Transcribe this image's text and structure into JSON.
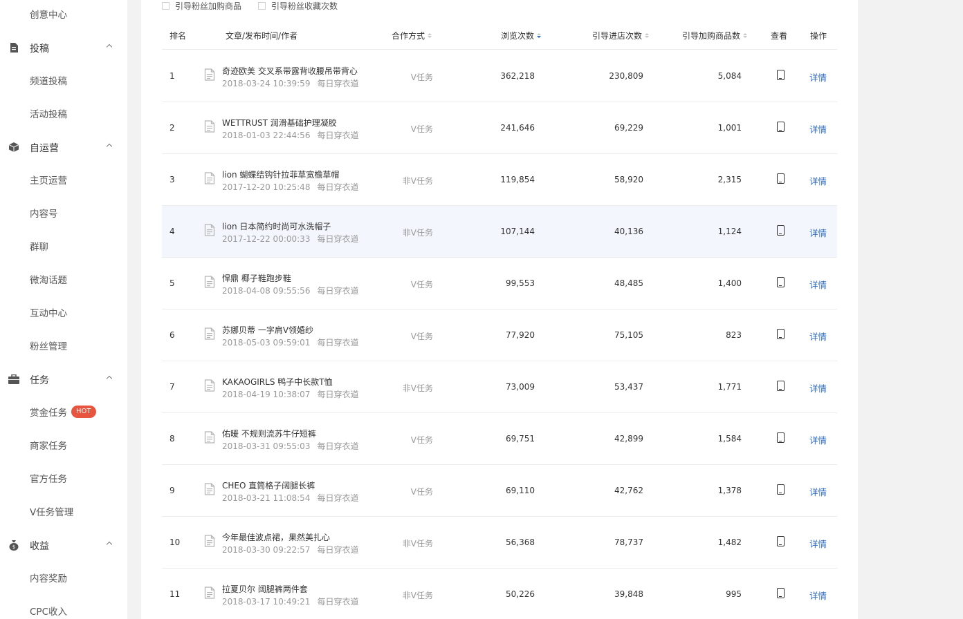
{
  "sidebar": {
    "top_item": "创意中心",
    "groups": [
      {
        "label": "投稿",
        "icon": "document-icon",
        "items": [
          "频道投稿",
          "活动投稿"
        ]
      },
      {
        "label": "自运营",
        "icon": "cube-icon",
        "items": [
          "主页运营",
          "内容号",
          "群聊",
          "微淘话题",
          "互动中心",
          "粉丝管理"
        ]
      },
      {
        "label": "任务",
        "icon": "briefcase-icon",
        "items": [
          "赏金任务",
          "商家任务",
          "官方任务",
          "V任务管理"
        ],
        "badge": "HOT"
      },
      {
        "label": "收益",
        "icon": "money-bag-icon",
        "items": [
          "内容奖励",
          "CPC收入"
        ]
      }
    ]
  },
  "filters": [
    "引导粉丝加购商品",
    "引导粉丝收藏次数"
  ],
  "table": {
    "headers": {
      "rank": "排名",
      "article": "文章/发布时间/作者",
      "coop": "合作方式",
      "views": "浏览次数",
      "store": "引导进店次数",
      "cart": "引导加购商品数",
      "view": "查看",
      "action": "操作"
    },
    "detail_label": "详情",
    "rows": [
      {
        "rank": "1",
        "title": "奇迹欧美 交叉系带露背收腰吊带背心",
        "date": "2018-03-24 10:39:59",
        "author": "每日穿衣道",
        "coop": "V任务",
        "views": "362,218",
        "store": "230,809",
        "cart": "5,084"
      },
      {
        "rank": "2",
        "title": "WETTRUST 润滑基础护理凝胶",
        "date": "2018-01-03 22:44:56",
        "author": "每日穿衣道",
        "coop": "V任务",
        "views": "241,646",
        "store": "69,229",
        "cart": "1,001"
      },
      {
        "rank": "3",
        "title": "lion 蝴蝶结钩针拉菲草宽檐草帽",
        "date": "2017-12-20 10:25:48",
        "author": "每日穿衣道",
        "coop": "非V任务",
        "views": "119,854",
        "store": "58,920",
        "cart": "2,315"
      },
      {
        "rank": "4",
        "title": "lion 日本简约时尚可水洗帽子",
        "date": "2017-12-22 00:00:33",
        "author": "每日穿衣道",
        "coop": "非V任务",
        "views": "107,144",
        "store": "40,136",
        "cart": "1,124"
      },
      {
        "rank": "5",
        "title": "悍鼎 椰子鞋跑步鞋",
        "date": "2018-04-08 09:55:56",
        "author": "每日穿衣道",
        "coop": "V任务",
        "views": "99,553",
        "store": "48,485",
        "cart": "1,400"
      },
      {
        "rank": "6",
        "title": "苏娜贝蒂 一字肩V领婚纱",
        "date": "2018-05-03 09:59:01",
        "author": "每日穿衣道",
        "coop": "V任务",
        "views": "77,920",
        "store": "75,105",
        "cart": "823"
      },
      {
        "rank": "7",
        "title": "KAKAOGIRLS 鸭子中长款T恤",
        "date": "2018-04-19 10:38:07",
        "author": "每日穿衣道",
        "coop": "非V任务",
        "views": "73,009",
        "store": "53,437",
        "cart": "1,771"
      },
      {
        "rank": "8",
        "title": "佑暖 不规则流苏牛仔短裤",
        "date": "2018-03-31 09:55:03",
        "author": "每日穿衣道",
        "coop": "V任务",
        "views": "69,751",
        "store": "42,899",
        "cart": "1,584"
      },
      {
        "rank": "9",
        "title": "CHEO 直筒格子阔腿长裤",
        "date": "2018-03-21 11:08:54",
        "author": "每日穿衣道",
        "coop": "V任务",
        "views": "69,110",
        "store": "42,762",
        "cart": "1,378"
      },
      {
        "rank": "10",
        "title": "今年最佳波点裙，果然美扎心",
        "date": "2018-03-30 09:22:57",
        "author": "每日穿衣道",
        "coop": "非V任务",
        "views": "56,368",
        "store": "78,737",
        "cart": "1,482"
      },
      {
        "rank": "11",
        "title": "拉夏贝尔 阔腿裤两件套",
        "date": "2018-03-17 10:49:21",
        "author": "每日穿衣道",
        "coop": "非V任务",
        "views": "50,226",
        "store": "39,848",
        "cart": "995"
      }
    ]
  }
}
